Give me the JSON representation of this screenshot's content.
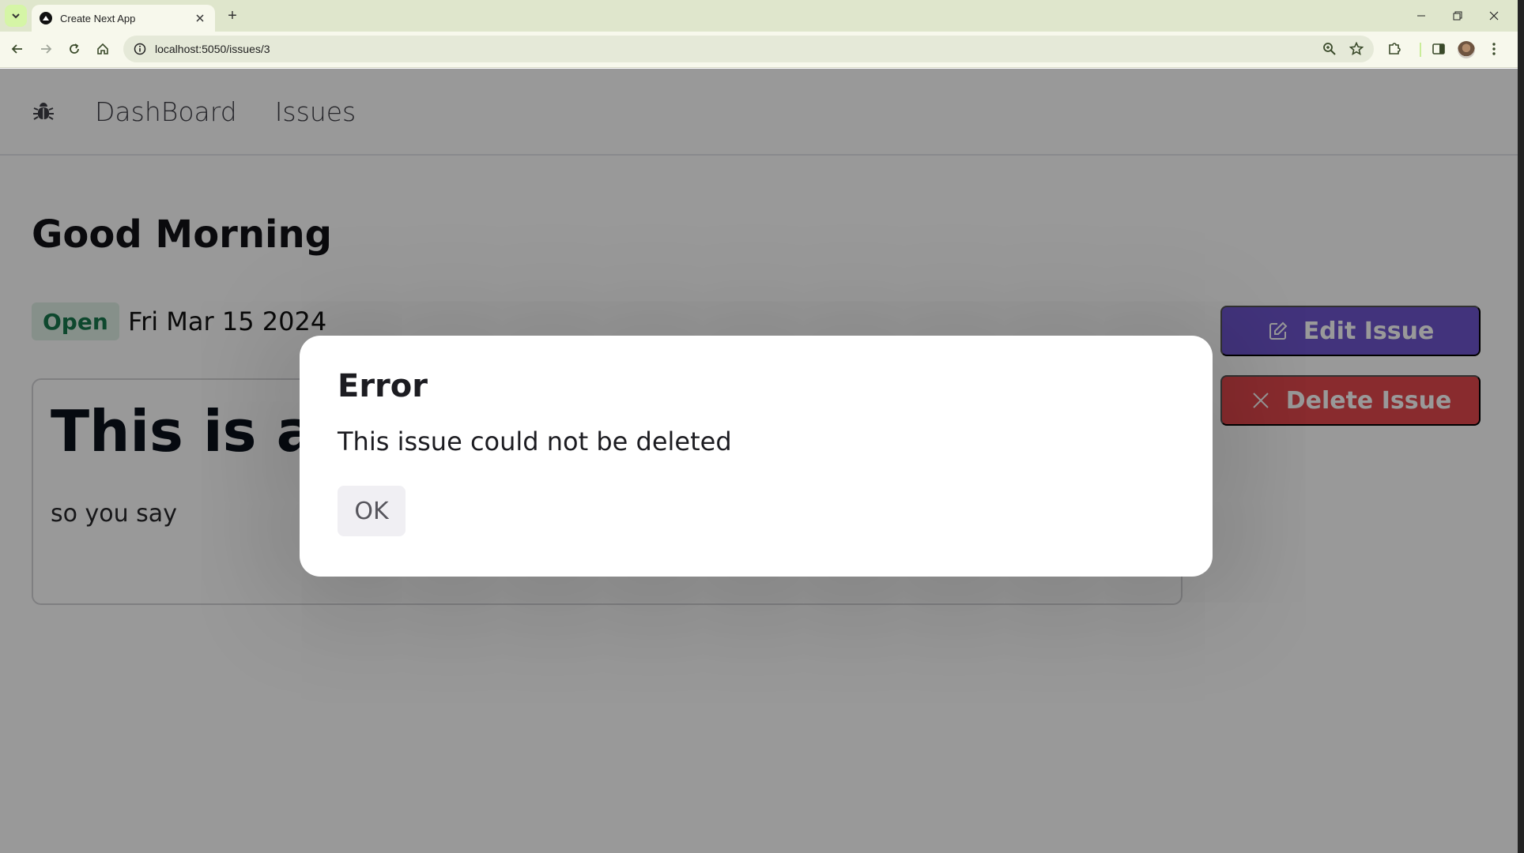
{
  "browser": {
    "tab": {
      "title": "Create Next App",
      "close_icon": "close-icon"
    },
    "new_tab_label": "+",
    "url": "localhost:5050/issues/3",
    "window_controls": [
      "minimize",
      "restore",
      "close"
    ]
  },
  "navbar": {
    "logo_icon": "bug-icon",
    "links": [
      {
        "label": "DashBoard"
      },
      {
        "label": "Issues"
      }
    ]
  },
  "issue": {
    "title": "Good Morning",
    "status": "Open",
    "date": "Fri Mar 15 2024",
    "description_heading": "This is a r",
    "description_body": "so you say"
  },
  "actions": {
    "edit_label": "Edit Issue",
    "delete_label": "Delete Issue"
  },
  "dialog": {
    "title": "Error",
    "message": "This issue could not be deleted",
    "ok_label": "OK"
  },
  "colors": {
    "edit_button": "#6e56cf",
    "delete_button": "#e5484d",
    "status_open_bg": "#dff1e6",
    "status_open_text": "#18794e"
  }
}
